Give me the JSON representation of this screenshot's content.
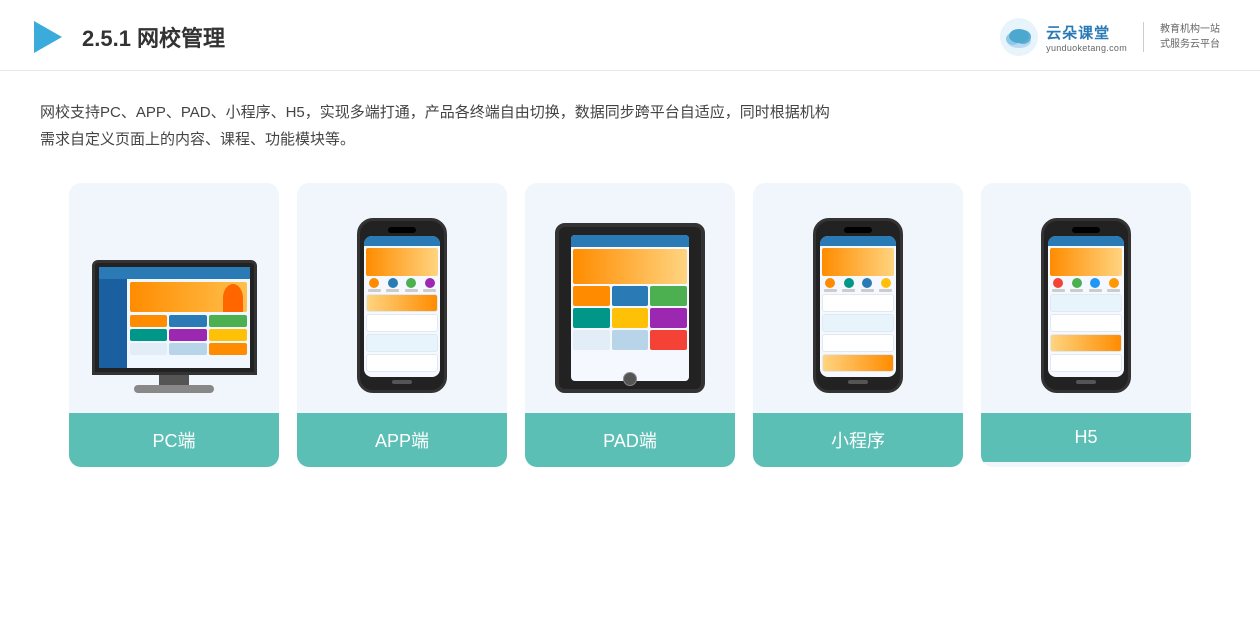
{
  "header": {
    "section_number": "2.5.1 ",
    "title": "网校管理",
    "logo": {
      "main": "云朵课堂",
      "url_hint": "yunduoketang.com",
      "tagline_line1": "教育机构一站",
      "tagline_line2": "式服务云平台"
    }
  },
  "description": {
    "text_line1": "网校支持PC、APP、PAD、小程序、H5，实现多端打通，产品各终端自由切换，数据同步跨平台自适应，同时根据机构",
    "text_line2": "需求自定义页面上的内容、课程、功能模块等。"
  },
  "cards": [
    {
      "id": "pc",
      "label": "PC端"
    },
    {
      "id": "app",
      "label": "APP端"
    },
    {
      "id": "pad",
      "label": "PAD端"
    },
    {
      "id": "mini",
      "label": "小程序"
    },
    {
      "id": "h5",
      "label": "H5"
    }
  ]
}
